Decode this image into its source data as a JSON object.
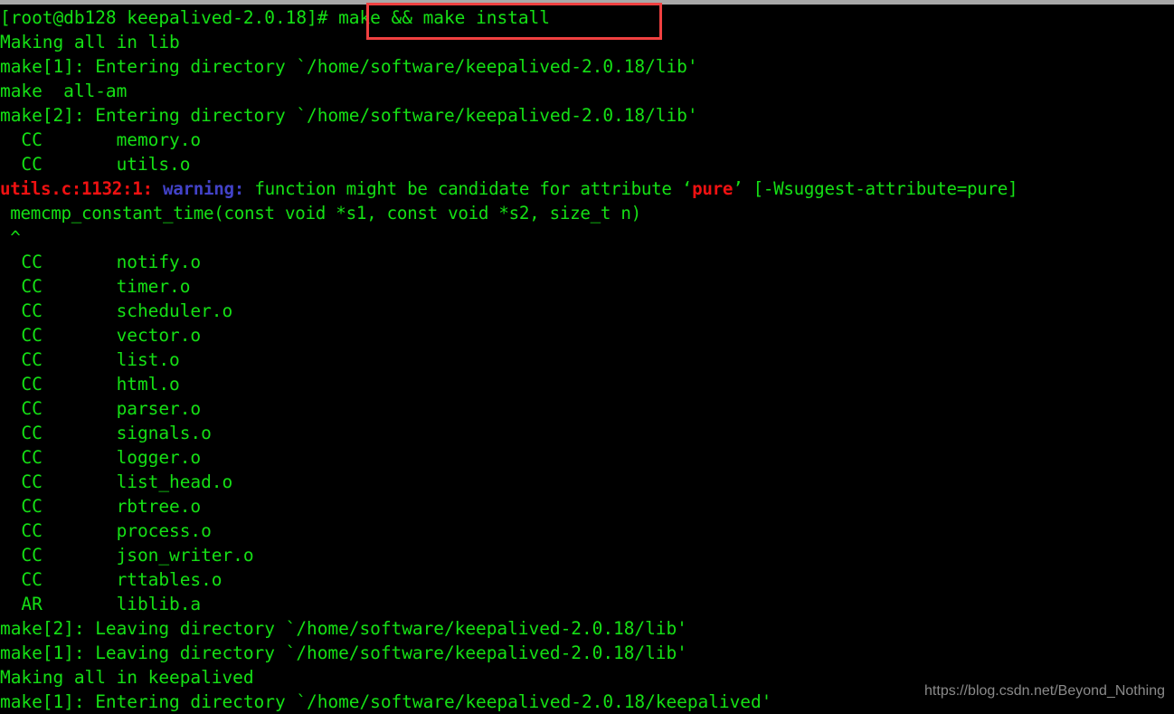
{
  "terminal": {
    "background_color": "#000000",
    "foreground_color": "#15e015",
    "error_color": "#ee1111",
    "warning_label_color": "#4242c8",
    "annotation_box_color": "#f04040",
    "watermark_color": "#8a8a8a",
    "prompt": "[root@db128 keepalived-2.0.18]# ",
    "command": "make && make install",
    "lines": [
      {
        "id": "line-prompt",
        "text": "[root@db128 keepalived-2.0.18]# make && make install"
      },
      {
        "id": "line-making-lib",
        "text": "Making all in lib"
      },
      {
        "id": "line-enter-1-lib",
        "text": "make[1]: Entering directory `/home/software/keepalived-2.0.18/lib'"
      },
      {
        "id": "line-make-allam",
        "text": "make  all-am"
      },
      {
        "id": "line-enter-2-lib",
        "text": "make[2]: Entering directory `/home/software/keepalived-2.0.18/lib'"
      },
      {
        "id": "line-cc-memory",
        "text": "  CC       memory.o"
      },
      {
        "id": "line-cc-utils",
        "text": "  CC       utils.o"
      },
      {
        "id": "line-warning",
        "text": "utils.c:1132:1: warning: function might be candidate for attribute 'pure' [-Wsuggest-attribute=pure]"
      },
      {
        "id": "line-warning-src",
        "text": " memcmp_constant_time(const void *s1, const void *s2, size_t n)"
      },
      {
        "id": "line-warning-caret",
        "text": " ^"
      },
      {
        "id": "line-cc-notify",
        "text": "  CC       notify.o"
      },
      {
        "id": "line-cc-timer",
        "text": "  CC       timer.o"
      },
      {
        "id": "line-cc-scheduler",
        "text": "  CC       scheduler.o"
      },
      {
        "id": "line-cc-vector",
        "text": "  CC       vector.o"
      },
      {
        "id": "line-cc-list",
        "text": "  CC       list.o"
      },
      {
        "id": "line-cc-html",
        "text": "  CC       html.o"
      },
      {
        "id": "line-cc-parser",
        "text": "  CC       parser.o"
      },
      {
        "id": "line-cc-signals",
        "text": "  CC       signals.o"
      },
      {
        "id": "line-cc-logger",
        "text": "  CC       logger.o"
      },
      {
        "id": "line-cc-listhead",
        "text": "  CC       list_head.o"
      },
      {
        "id": "line-cc-rbtree",
        "text": "  CC       rbtree.o"
      },
      {
        "id": "line-cc-process",
        "text": "  CC       process.o"
      },
      {
        "id": "line-cc-jsonwriter",
        "text": "  CC       json_writer.o"
      },
      {
        "id": "line-cc-rttables",
        "text": "  CC       rttables.o"
      },
      {
        "id": "line-ar-liblib",
        "text": "  AR       liblib.a"
      },
      {
        "id": "line-leave-2-lib",
        "text": "make[2]: Leaving directory `/home/software/keepalived-2.0.18/lib'"
      },
      {
        "id": "line-leave-1-lib",
        "text": "make[1]: Leaving directory `/home/software/keepalived-2.0.18/lib'"
      },
      {
        "id": "line-making-keepalived",
        "text": "Making all in keepalived"
      },
      {
        "id": "line-enter-1-keepalived",
        "text": "make[1]: Entering directory `/home/software/keepalived-2.0.18/keepalived'"
      }
    ],
    "warning_parts": {
      "location": "utils.c:1132:1:",
      "space1": " ",
      "label": "warning:",
      "message_before": " function might be candidate for attribute ‘",
      "attribute": "pure",
      "message_after": "’ [-Wsuggest-attribute=pure]"
    },
    "watermark": "https://blog.csdn.net/Beyond_Nothing"
  }
}
